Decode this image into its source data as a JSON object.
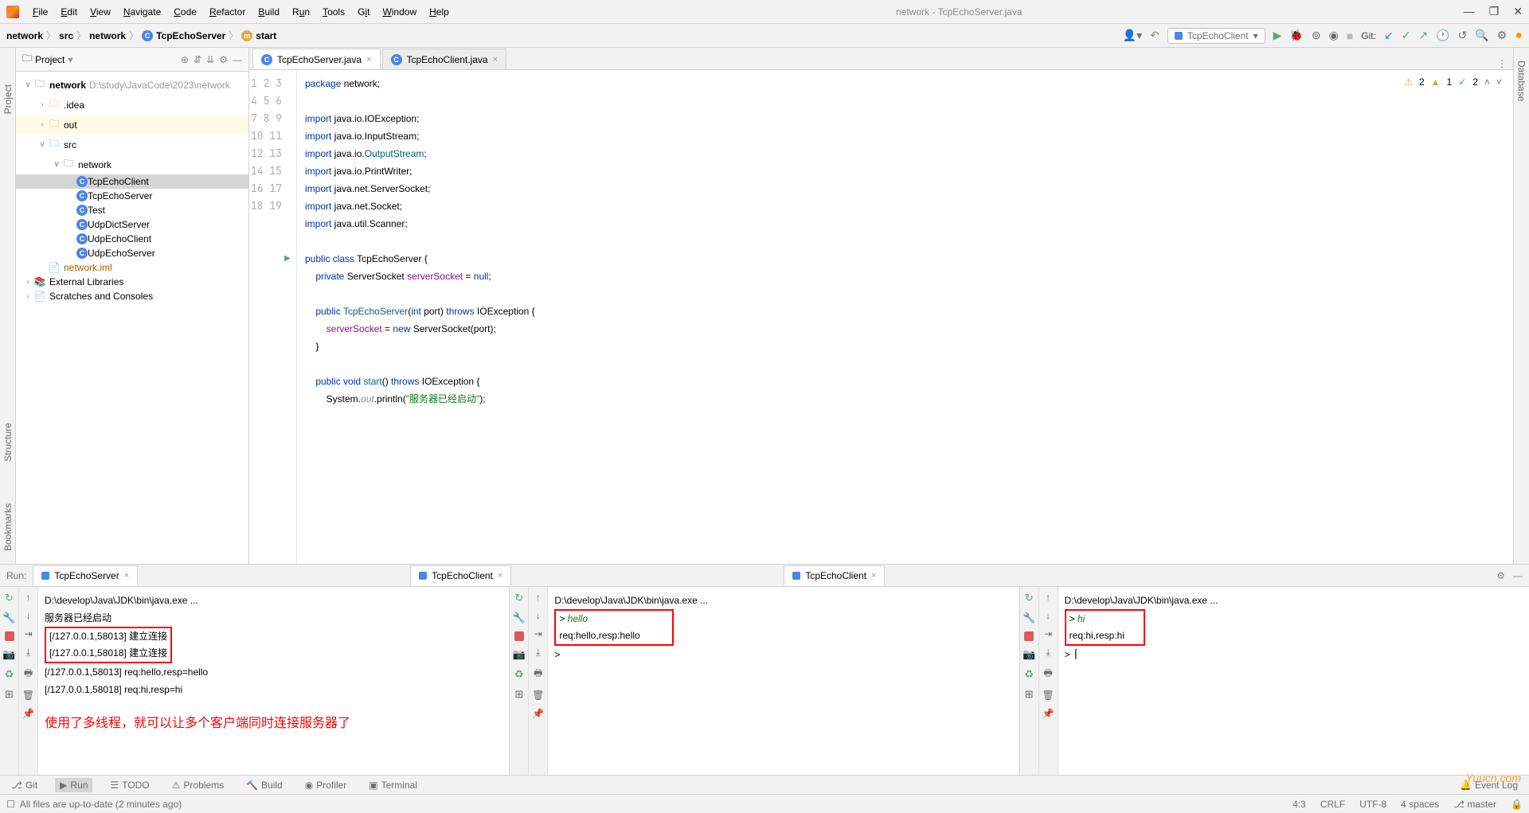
{
  "window": {
    "title": "network - TcpEchoServer.java"
  },
  "menu": [
    "File",
    "Edit",
    "View",
    "Navigate",
    "Code",
    "Refactor",
    "Build",
    "Run",
    "Tools",
    "Git",
    "Window",
    "Help"
  ],
  "breadcrumb": {
    "project": "network",
    "src": "src",
    "pkg": "network",
    "class": "TcpEchoServer",
    "method": "start"
  },
  "nav": {
    "runConfig": "TcpEchoClient",
    "gitLabel": "Git:"
  },
  "projectPanel": {
    "title": "Project"
  },
  "tree": {
    "root": "network",
    "rootPath": "D:\\study\\JavaCode\\2023\\network",
    "idea": ".idea",
    "out": "out",
    "src": "src",
    "pkg": "network",
    "files": [
      "TcpEchoClient",
      "TcpEchoServer",
      "Test",
      "UdpDictServer",
      "UdpEchoClient",
      "UdpEchoServer"
    ],
    "iml": "network.iml",
    "ext": "External Libraries",
    "scratch": "Scratches and Consoles"
  },
  "editorTabs": {
    "t1": "TcpEchoServer.java",
    "t2": "TcpEchoClient.java"
  },
  "warnings": {
    "yellow": "2",
    "amber": "1",
    "green": "2"
  },
  "code": {
    "l1a": "package",
    "l1b": " network;",
    "l3a": "import",
    "l3b": " java.io.IOException;",
    "l4a": "import",
    "l4b": " java.io.InputStream;",
    "l5a": "import",
    "l5b": " java.io.",
    "l5c": "OutputStream",
    "l5d": ";",
    "l6a": "import",
    "l6b": " java.io.PrintWriter;",
    "l7a": "import",
    "l7b": " java.net.ServerSocket;",
    "l8a": "import",
    "l8b": " java.net.Socket;",
    "l9a": "import",
    "l9b": " java.util.Scanner;",
    "l11a": "public class ",
    "l11b": "TcpEchoServer",
    "l11c": " {",
    "l12a": "    private ",
    "l12b": "ServerSocket ",
    "l12c": "serverSocket",
    "l12d": " = ",
    "l12e": "null",
    "l12f": ";",
    "l14a": "    public ",
    "l14b": "TcpEchoServer",
    "l14c": "(",
    "l14d": "int ",
    "l14e": "port",
    "l14f": ") ",
    "l14g": "throws ",
    "l14h": "IOException {",
    "l15a": "        ",
    "l15b": "serverSocket",
    "l15c": " = ",
    "l15d": "new ",
    "l15e": "ServerSocket(",
    "l15f": "port",
    "l15g": ");",
    "l16": "    }",
    "l18a": "    public void ",
    "l18b": "start",
    "l18c": "() ",
    "l18d": "throws ",
    "l18e": "IOException {",
    "l19a": "        System.",
    "l19b": "out",
    "l19c": ".println(",
    "l19d": "\"服务器已经启动\"",
    "l19e": ");"
  },
  "run": {
    "label": "Run:",
    "tabs": [
      "TcpEchoServer",
      "TcpEchoClient",
      "TcpEchoClient"
    ],
    "server": {
      "cmd": "D:\\develop\\Java\\JDK\\bin\\java.exe ...",
      "l2": "服务器已经启动",
      "l3": "[/127.0.0.1,58013] 建立连接",
      "l4": "[/127.0.0.1,58018] 建立连接",
      "l5": "[/127.0.0.1,58013] req:hello,resp=hello",
      "l6": "[/127.0.0.1,58018] req:hi,resp=hi",
      "note": "使用了多线程，就可以让多个客户端同时连接服务器了"
    },
    "client1": {
      "cmd": "D:\\develop\\Java\\JDK\\bin\\java.exe ...",
      "l2": "> ",
      "l2b": "hello",
      "l3": "req:hello,resp:hello",
      "l4": "> "
    },
    "client2": {
      "cmd": "D:\\develop\\Java\\JDK\\bin\\java.exe ...",
      "l2": "> ",
      "l2b": "hi",
      "l3": "req:hi,resp:hi",
      "l4": "> "
    }
  },
  "bottomTabs": {
    "git": "Git",
    "run": "Run",
    "todo": "TODO",
    "problems": "Problems",
    "build": "Build",
    "profiler": "Profiler",
    "terminal": "Terminal",
    "eventLog": "Event Log"
  },
  "status": {
    "msg": "All files are up-to-date (2 minutes ago)",
    "pos": "4:3",
    "crlf": "CRLF",
    "enc": "UTF-8",
    "indent": "4 spaces",
    "branch": "master"
  },
  "sideLabels": {
    "project": "Project",
    "bookmarks": "Bookmarks",
    "structure": "Structure",
    "database": "Database"
  },
  "watermark": "Yuucn.com"
}
